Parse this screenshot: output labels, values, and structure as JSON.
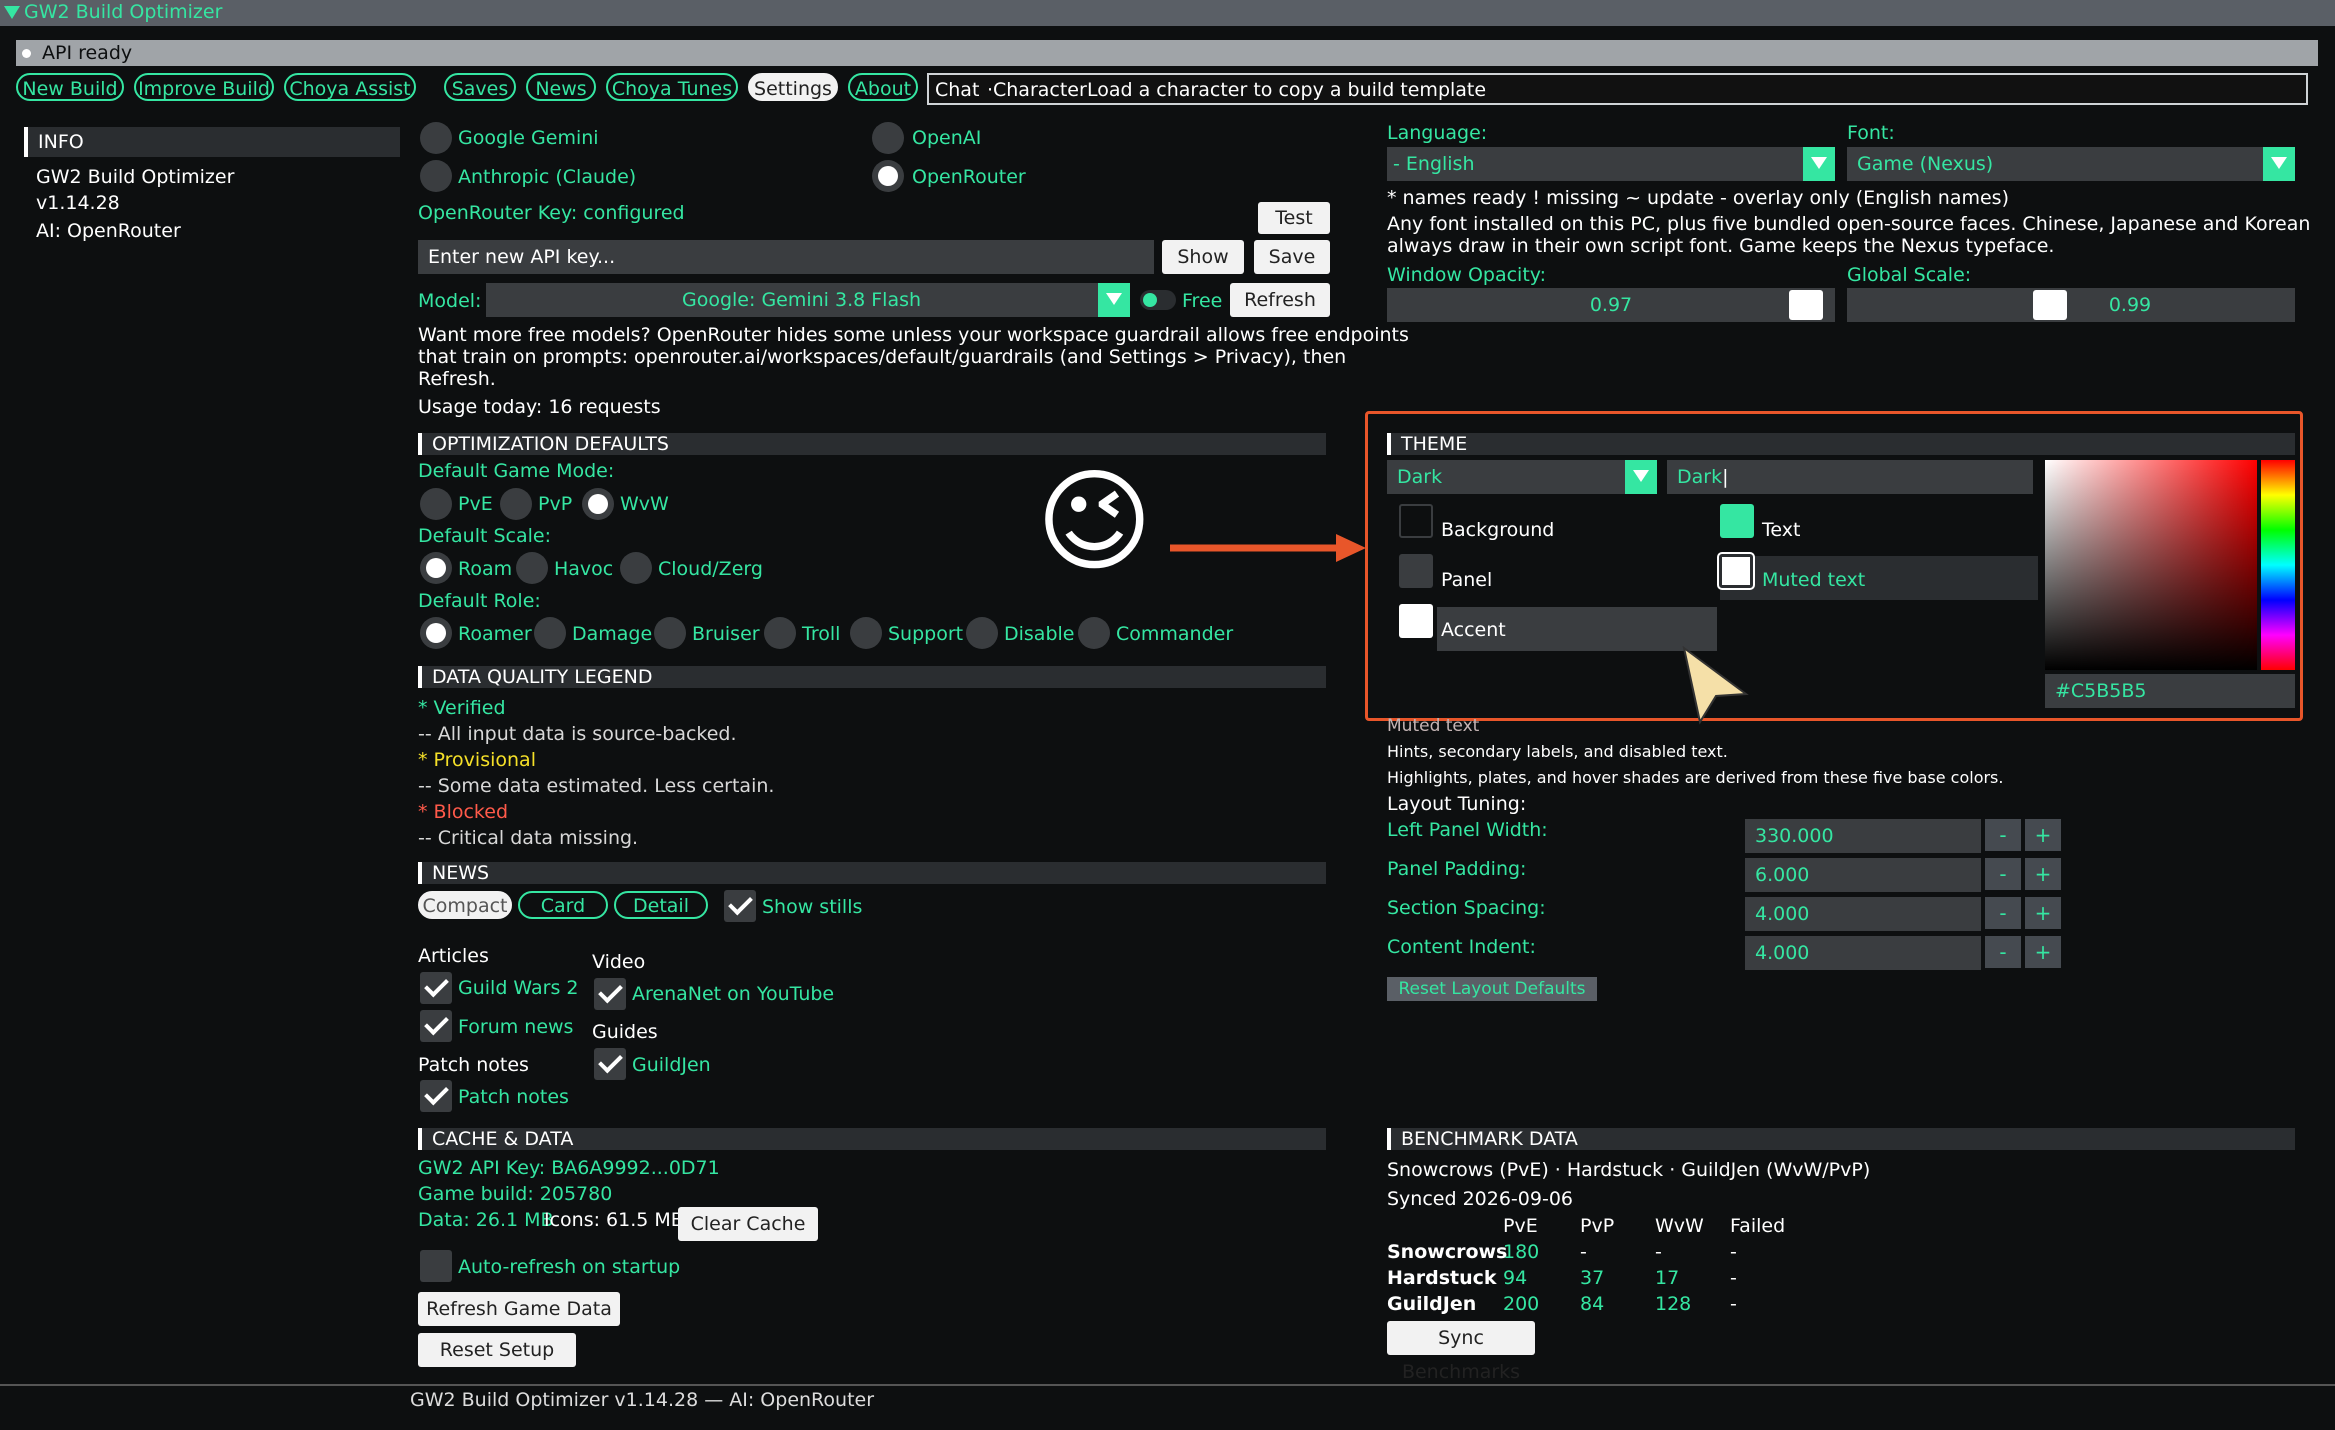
{
  "window": {
    "title": "GW2 Build Optimizer"
  },
  "status": {
    "text": "API ready"
  },
  "tabs": [
    {
      "label": "New Build"
    },
    {
      "label": "Improve Build"
    },
    {
      "label": "Choya Assist"
    },
    {
      "label": "Saves"
    },
    {
      "label": "News"
    },
    {
      "label": "Choya Tunes"
    },
    {
      "label": "Settings",
      "selected": true
    },
    {
      "label": "About"
    }
  ],
  "chat": {
    "chat_label": "Chat",
    "character_label": "Character",
    "hint": "Load a character to copy a build template"
  },
  "info": {
    "header": "INFO",
    "app_name": "GW2 Build Optimizer",
    "version": "v1.14.28",
    "ai": "AI: OpenRouter"
  },
  "ai_providers": {
    "options": [
      "Google Gemini",
      "OpenAI",
      "Anthropic (Claude)",
      "OpenRouter"
    ],
    "selected": "OpenRouter"
  },
  "openrouter": {
    "key_status": "OpenRouter Key: configured",
    "test_label": "Test",
    "key_placeholder": "Enter new API key...",
    "show_label": "Show",
    "save_label": "Save",
    "model_label": "Model:",
    "model_value": "Google: Gemini 3.8 Flash",
    "free_label": "Free",
    "refresh_label": "Refresh",
    "note_line1": "Want more free models? OpenRouter hides some unless your workspace guardrail allows free endpoints",
    "note_line2": "that train on prompts: openrouter.ai/workspaces/default/guardrails (and Settings > Privacy), then",
    "note_line3": "Refresh.",
    "usage": "Usage today: 16 requests"
  },
  "opt_defaults": {
    "header": "OPTIMIZATION DEFAULTS",
    "game_mode_label": "Default Game Mode:",
    "game_modes": [
      "PvE",
      "PvP",
      "WvW"
    ],
    "game_mode_selected": "WvW",
    "scale_label": "Default Scale:",
    "scales": [
      "Roam",
      "Havoc",
      "Cloud/Zerg"
    ],
    "scale_selected": "Roam",
    "role_label": "Default Role:",
    "roles": [
      "Roamer",
      "Damage",
      "Bruiser",
      "Troll",
      "Support",
      "Disable",
      "Commander"
    ],
    "role_selected": "Roamer"
  },
  "legend": {
    "header": "DATA QUALITY LEGEND",
    "verified": "* Verified",
    "verified_desc": "-- All input data is source-backed.",
    "provisional": "* Provisional",
    "provisional_desc": "-- Some data estimated. Less certain.",
    "blocked": "* Blocked",
    "blocked_desc": "-- Critical data missing.",
    "colors": {
      "verified": "#35e6a2",
      "provisional": "#f5e028",
      "blocked": "#ff5a4a"
    }
  },
  "news": {
    "header": "NEWS",
    "views": [
      "Compact",
      "Card",
      "Detail"
    ],
    "view_selected": "Compact",
    "show_stills": "Show stills",
    "articles_label": "Articles",
    "guild_wars_2": "Guild Wars 2",
    "forum_news": "Forum news",
    "patch_notes_label": "Patch notes",
    "patch_notes": "Patch notes",
    "video_label": "Video",
    "arenanet_youtube": "ArenaNet on YouTube",
    "guides_label": "Guides",
    "guildjen": "GuildJen"
  },
  "cache": {
    "header": "CACHE & DATA",
    "api_key": "GW2 API Key: BA6A9992...0D71",
    "game_build": "Game build: 205780",
    "data_size": "Data: 26.1 MB",
    "icons_size": "Icons: 61.5 MB",
    "clear_cache": "Clear Cache",
    "auto_refresh": "Auto-refresh on startup",
    "refresh_game_data": "Refresh Game Data",
    "reset_setup": "Reset Setup"
  },
  "footer": {
    "text": "GW2 Build Optimizer v1.14.28  —  AI: OpenRouter"
  },
  "display": {
    "language_label": "Language:",
    "language_value": "- English",
    "font_label": "Font:",
    "font_value": "Game (Nexus)",
    "names_legend": "* names ready   ! missing   ~ update   - overlay only (English names)",
    "font_note1": "Any font installed on this PC, plus five bundled open-source faces. Chinese, Japanese and Korean",
    "font_note2": "always draw in their own script font. Game keeps the Nexus typeface.",
    "opacity_label": "Window Opacity:",
    "opacity_value": "0.97",
    "opacity_fraction": 0.97,
    "scale_label": "Global Scale:",
    "scale_value": "0.99",
    "scale_fraction": 0.45
  },
  "theme": {
    "header": "THEME",
    "preset_value": "Dark",
    "name_value": "Dark",
    "background_label": "Background",
    "panel_label": "Panel",
    "accent_label": "Accent",
    "text_label": "Text",
    "muted_label": "Muted text",
    "hex_value": "#C5B5B5",
    "colors": {
      "background": "#0d0f10",
      "panel": "#3a3d40",
      "accent": "#ffffff",
      "text": "#35e6a2",
      "muted": "#c5b5b5",
      "highlight_box": "#e8562a"
    }
  },
  "muted_help": {
    "title": "Muted text",
    "desc1": "Hints, secondary labels, and disabled text.",
    "desc2": "Highlights, plates, and hover shades are derived from these five base colors."
  },
  "layout_tuning": {
    "label": "Layout Tuning:",
    "rows": [
      {
        "label": "Left Panel Width:",
        "value": "330.000"
      },
      {
        "label": "Panel Padding:",
        "value": "6.000"
      },
      {
        "label": "Section Spacing:",
        "value": "4.000"
      },
      {
        "label": "Content Indent:",
        "value": "4.000"
      }
    ],
    "minus": "-",
    "plus": "+",
    "reset_label": "Reset Layout Defaults"
  },
  "benchmark": {
    "header": "BENCHMARK DATA",
    "sources": "Snowcrows (PvE) · Hardstuck · GuildJen (WvW/PvP)",
    "synced": "Synced 2026-09-06",
    "columns": [
      "",
      "PvE",
      "PvP",
      "WvW",
      "Failed"
    ],
    "rows": [
      [
        "Snowcrows",
        "180",
        "-",
        "-",
        "-"
      ],
      [
        "Hardstuck",
        "94",
        "37",
        "17",
        "-"
      ],
      [
        "GuildJen",
        "200",
        "84",
        "128",
        "-"
      ]
    ],
    "sync_label": "Sync Benchmarks"
  },
  "annotation": {
    "emoji": "😉"
  }
}
